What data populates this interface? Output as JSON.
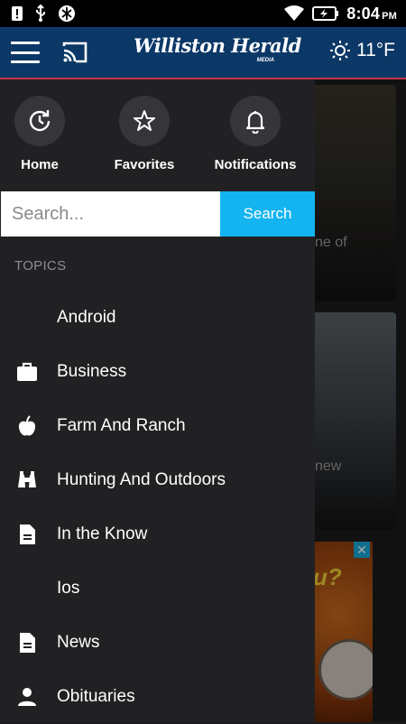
{
  "status_bar": {
    "time": "8:04",
    "ampm": "PM"
  },
  "app_bar": {
    "logo_text": "Williston Herald",
    "logo_subtext": "MEDIA",
    "temperature": "11°F",
    "weather_icon": "sun-icon"
  },
  "drawer": {
    "quick_actions": [
      {
        "label": "Home",
        "icon": "refresh-clock-icon"
      },
      {
        "label": "Favorites",
        "icon": "star-icon"
      },
      {
        "label": "Notifications",
        "icon": "bell-icon"
      }
    ],
    "search": {
      "placeholder": "Search...",
      "value": "",
      "button_label": "Search"
    },
    "topics_heading": "TOPICS",
    "topics": [
      {
        "label": "Android",
        "icon": ""
      },
      {
        "label": "Business",
        "icon": "briefcase-icon"
      },
      {
        "label": "Farm And Ranch",
        "icon": "apple-icon"
      },
      {
        "label": "Hunting And Outdoors",
        "icon": "binoculars-icon"
      },
      {
        "label": "In the Know",
        "icon": "document-icon"
      },
      {
        "label": "Ios",
        "icon": ""
      },
      {
        "label": "News",
        "icon": "document-icon"
      },
      {
        "label": "Obituaries",
        "icon": "person-icon"
      }
    ]
  },
  "feed_background": {
    "card1_text": "ne of",
    "card2_text": "new",
    "ad_text": "u?",
    "ad_close": "✕"
  },
  "colors": {
    "app_bar": "#0c3867",
    "accent_line": "#c7344a",
    "drawer_bg": "#212124",
    "search_button": "#13b4f0"
  }
}
